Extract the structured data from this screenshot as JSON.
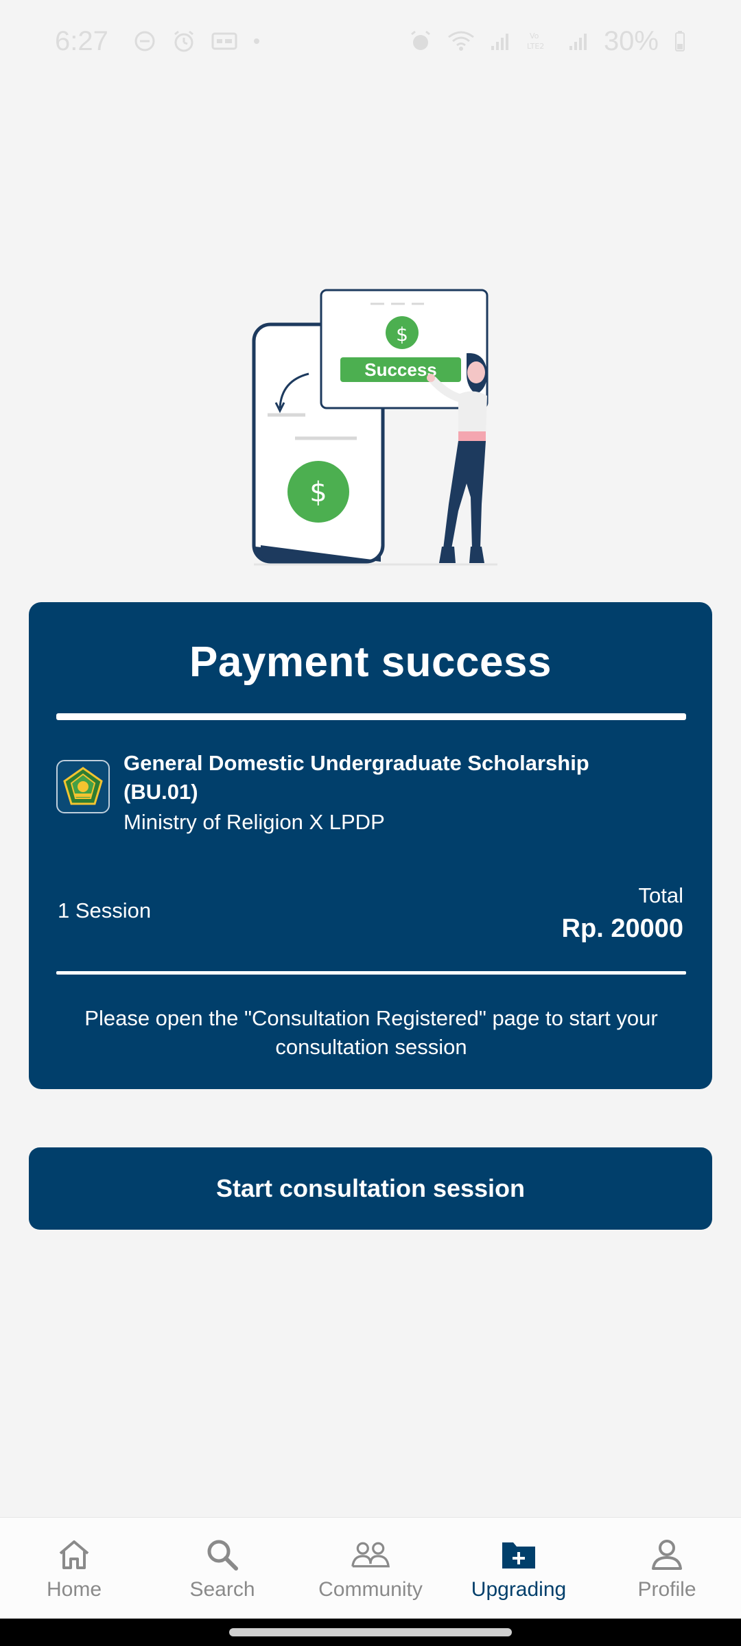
{
  "status_bar": {
    "time": "6:27",
    "battery": "30%",
    "icons": [
      "do-not-disturb-icon",
      "alarm-icon",
      "card-icon",
      "dot-icon",
      "alarm-icon",
      "wifi-icon",
      "signal-icon",
      "volte-icon",
      "signal-icon"
    ]
  },
  "illustration": {
    "success_label": "Success",
    "dollar_symbol": "$"
  },
  "card": {
    "title": "Payment success",
    "scholarship_name": "General Domestic Undergraduate  Scholarship (BU.01)",
    "organization": "Ministry of Religion X LPDP",
    "session_count": "1 Session",
    "total_label": "Total",
    "total_value": "Rp. 20000",
    "note": "Please open the \"Consultation Registered\" page to start your consultation session"
  },
  "cta": {
    "label": "Start consultation session"
  },
  "nav": {
    "items": [
      {
        "label": "Home",
        "icon": "home-icon",
        "active": false
      },
      {
        "label": "Search",
        "icon": "search-icon",
        "active": false
      },
      {
        "label": "Community",
        "icon": "community-icon",
        "active": false
      },
      {
        "label": "Upgrading",
        "icon": "folder-plus-icon",
        "active": true
      },
      {
        "label": "Profile",
        "icon": "profile-icon",
        "active": false
      }
    ]
  },
  "colors": {
    "primary": "#013f6b",
    "success_green": "#4caf50",
    "background": "#f4f4f4",
    "inactive_nav": "#8a8a8a"
  }
}
